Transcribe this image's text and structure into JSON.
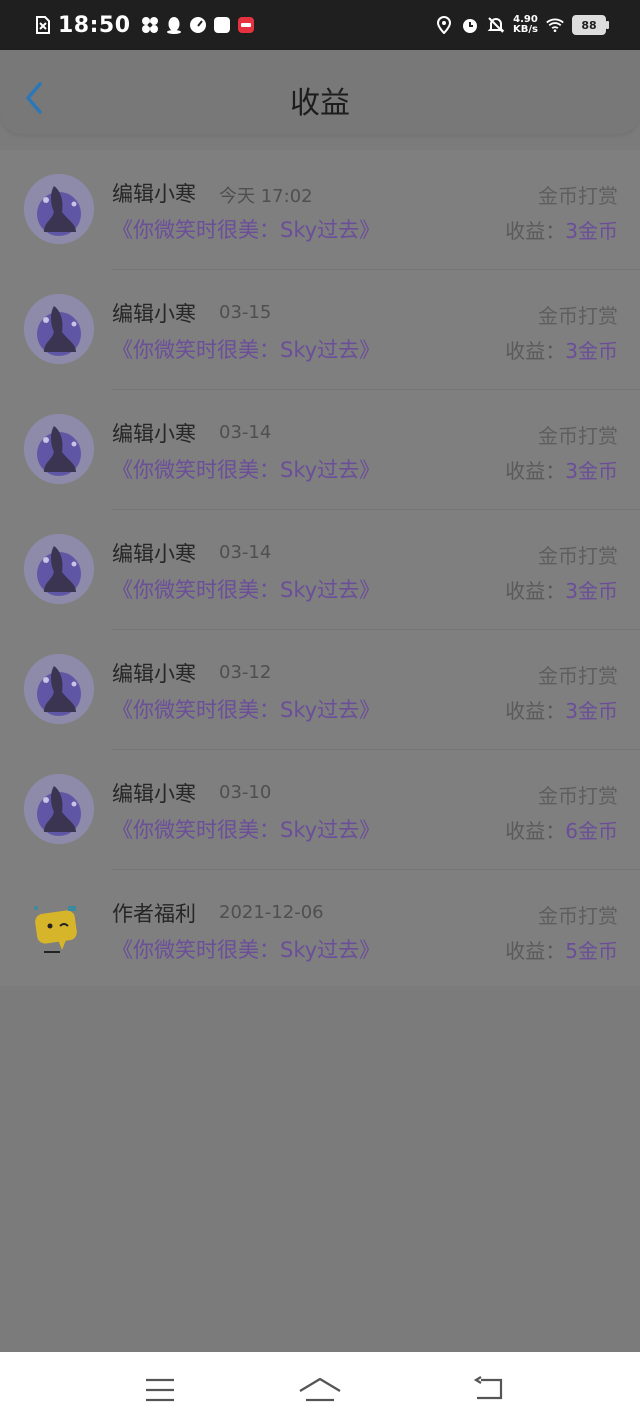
{
  "status_bar": {
    "time": "18:50",
    "net_speed_value": "4.90",
    "net_speed_unit": "KB/s",
    "battery": "88"
  },
  "header": {
    "title": "收益"
  },
  "income_list": [
    {
      "name": "编辑小寒",
      "date": "今天 17:02",
      "reward_type": "金币打赏",
      "book": "《你微笑时很美：Sky过去》",
      "income_label": "收益：",
      "income_amount": "3金币"
    },
    {
      "name": "编辑小寒",
      "date": "03-15",
      "reward_type": "金币打赏",
      "book": "《你微笑时很美：Sky过去》",
      "income_label": "收益：",
      "income_amount": "3金币"
    },
    {
      "name": "编辑小寒",
      "date": "03-14",
      "reward_type": "金币打赏",
      "book": "《你微笑时很美：Sky过去》",
      "income_label": "收益：",
      "income_amount": "3金币"
    },
    {
      "name": "编辑小寒",
      "date": "03-14",
      "reward_type": "金币打赏",
      "book": "《你微笑时很美：Sky过去》",
      "income_label": "收益：",
      "income_amount": "3金币"
    },
    {
      "name": "编辑小寒",
      "date": "03-12",
      "reward_type": "金币打赏",
      "book": "《你微笑时很美：Sky过去》",
      "income_label": "收益：",
      "income_amount": "3金币"
    },
    {
      "name": "编辑小寒",
      "date": "03-10",
      "reward_type": "金币打赏",
      "book": "《你微笑时很美：Sky过去》",
      "income_label": "收益：",
      "income_amount": "6金币"
    },
    {
      "name": "作者福利",
      "date": "2021-12-06",
      "reward_type": "金币打赏",
      "book": "《你微笑时很美：Sky过去》",
      "income_label": "收益：",
      "income_amount": "5金币"
    }
  ],
  "colors": {
    "accent_purple": "#6a4e9a",
    "back_arrow_blue": "#2b78b8",
    "overlay_gray": "#7b7b7b"
  },
  "icons": {
    "back": "chevron-left-icon",
    "nav_menu": "menu-icon",
    "nav_home": "home-icon",
    "nav_back": "return-icon"
  }
}
